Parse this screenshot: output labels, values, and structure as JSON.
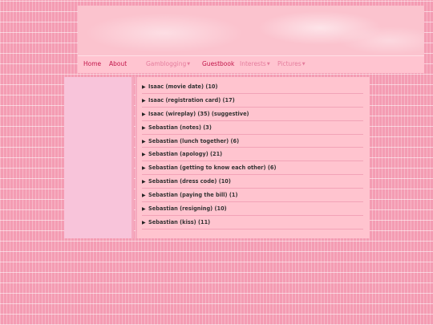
{
  "nav": {
    "home": "Home",
    "about": "About",
    "gamblogging": "Gamblogging",
    "guestbook": "Guestbook",
    "interests": "Interests",
    "pictures": "Pictures"
  },
  "archive": [
    {
      "label": "Isaac (movie date) (10)"
    },
    {
      "label": "Isaac (registration card) (17)"
    },
    {
      "label": "Isaac (wireplay) (35) (suggestive)"
    },
    {
      "label": "Sebastian (notes) (3)"
    },
    {
      "label": "Sebastian (lunch together) (6)"
    },
    {
      "label": "Sebastian (apology) (21)"
    },
    {
      "label": "Sebastian (getting to know each other) (6)"
    },
    {
      "label": "Sebastian (dress code) (10)"
    },
    {
      "label": "Sebastian (paying the bill) (1)"
    },
    {
      "label": "Sebastian (resigning) (10)"
    },
    {
      "label": "Sebastian (kiss) (11)"
    }
  ],
  "icons": {
    "item_expander": "triangle-right-icon",
    "dropdown": "caret-down-icon"
  },
  "colors": {
    "accent": "#c2164a",
    "background": "#f49cb3",
    "panel": "#ffc4cf"
  }
}
